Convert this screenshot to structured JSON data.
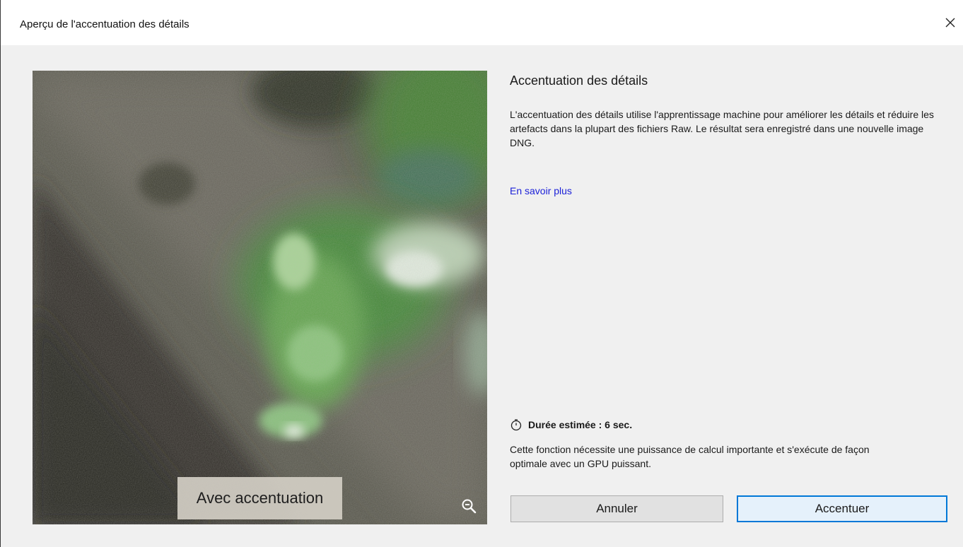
{
  "window": {
    "title": "Aperçu de l'accentuation des détails",
    "close_icon": "close-icon"
  },
  "preview": {
    "label": "Avec accentuation",
    "zoom_icon": "zoom-out-icon"
  },
  "info": {
    "heading": "Accentuation des détails",
    "description": "L'accentuation des détails utilise l'apprentissage machine pour améliorer les détails et réduire les artefacts dans la plupart des fichiers Raw. Le résultat sera enregistré dans une nouvelle image DNG.",
    "learn_more": "En savoir plus",
    "duration_icon": "timer-icon",
    "duration": "Durée estimée : 6 sec.",
    "note": "Cette fonction nécessite une puissance de calcul importante et s'exécute de façon optimale avec un GPU puissant."
  },
  "buttons": {
    "cancel": "Annuler",
    "confirm": "Accentuer"
  },
  "colors": {
    "dialog_bg": "#f0f0f0",
    "link": "#1a1fd8",
    "primary_border": "#0078d7"
  }
}
